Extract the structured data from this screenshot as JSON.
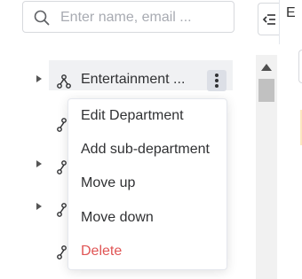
{
  "search": {
    "placeholder": "Enter name, email ..."
  },
  "header": {
    "right_edge_text": "E"
  },
  "tree": {
    "selected_node_label": "Entertainment ..."
  },
  "context_menu": {
    "items": [
      {
        "label": "Edit Department"
      },
      {
        "label": "Add sub-department"
      },
      {
        "label": "Move up"
      },
      {
        "label": "Move down"
      },
      {
        "label": "Delete",
        "danger": true
      }
    ]
  },
  "colors": {
    "danger": "#e05555",
    "selected_row": "#f0f1f3"
  }
}
